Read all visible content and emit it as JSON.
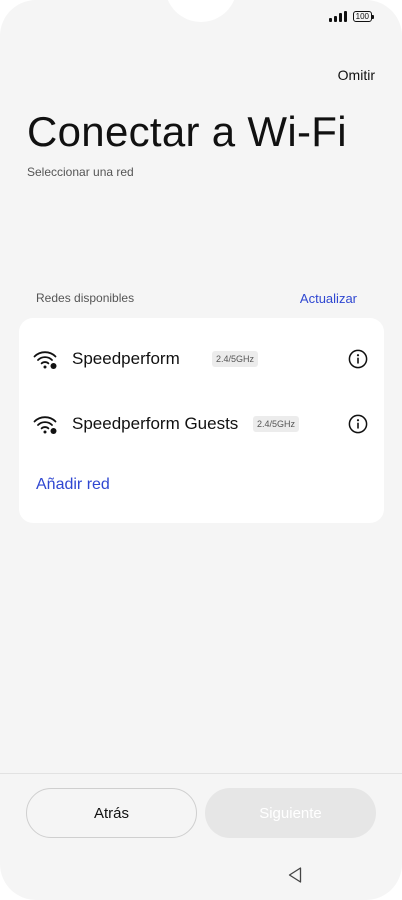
{
  "status_bar": {
    "battery": "100"
  },
  "header": {
    "skip_label": "Omitir",
    "title": "Conectar a Wi-Fi",
    "subtitle": "Seleccionar una red"
  },
  "networks_section": {
    "label": "Redes disponibles",
    "refresh_label": "Actualizar",
    "networks": [
      {
        "name": "Speedperform",
        "band": "2.4/5GHz",
        "icon": "wifi-secured-icon"
      },
      {
        "name": "Speedperform Guests",
        "band": "2.4/5GHz",
        "icon": "wifi-secured-icon"
      }
    ],
    "add_network_label": "Añadir red"
  },
  "footer": {
    "back_label": "Atrás",
    "next_label": "Siguiente"
  },
  "colors": {
    "accent": "#2f47d1",
    "background": "#f5f5f5",
    "card": "#ffffff",
    "disabled_button": "#e6e6e6"
  }
}
